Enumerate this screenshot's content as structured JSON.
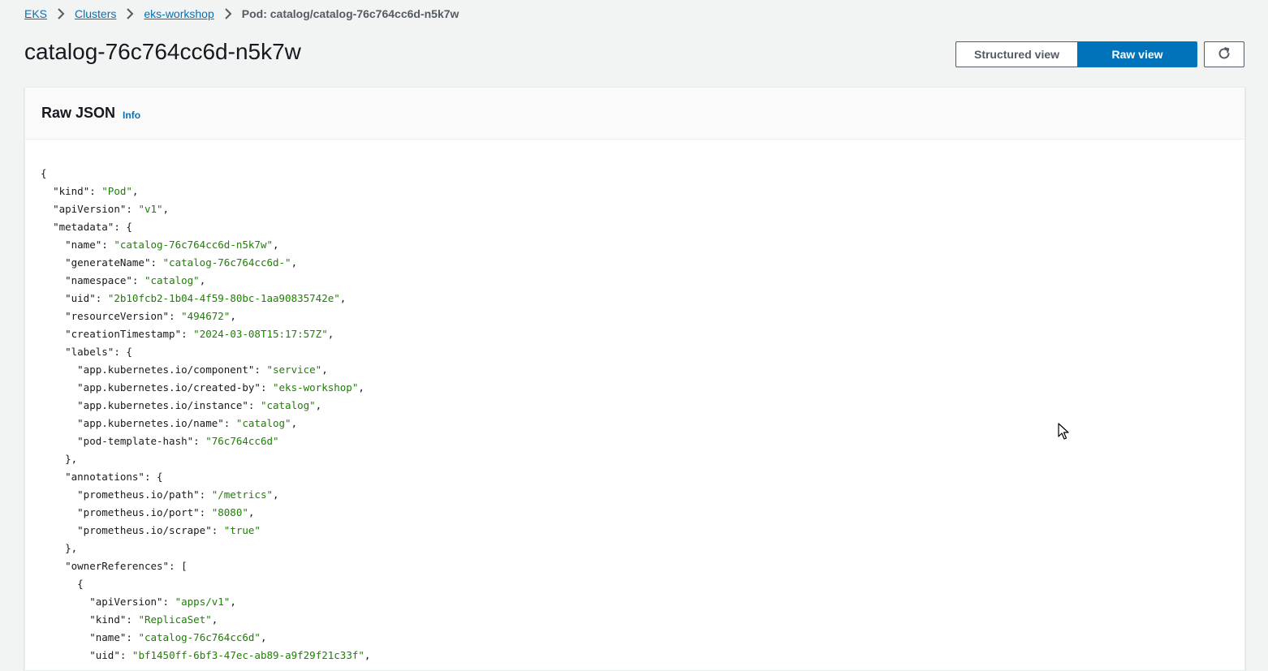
{
  "breadcrumb": {
    "items": [
      "EKS",
      "Clusters",
      "eks-workshop"
    ],
    "current": "Pod: catalog/catalog-76c764cc6d-n5k7w"
  },
  "page": {
    "title": "catalog-76c764cc6d-n5k7w"
  },
  "view_toggle": {
    "structured_label": "Structured view",
    "raw_label": "Raw view",
    "selected": "Raw view"
  },
  "refresh": {
    "icon": "refresh-icon"
  },
  "panel": {
    "title": "Raw JSON",
    "info_label": "Info"
  },
  "colors": {
    "accent": "#0073bb",
    "string": "#1d8102",
    "background": "#f2f3f3"
  },
  "json_lines": [
    {
      "indent": 0,
      "text": "{"
    },
    {
      "indent": 1,
      "key": "kind",
      "value": "Pod",
      "comma": true
    },
    {
      "indent": 1,
      "key": "apiVersion",
      "value": "v1",
      "comma": true
    },
    {
      "indent": 1,
      "key": "metadata",
      "open": "{"
    },
    {
      "indent": 2,
      "key": "name",
      "value": "catalog-76c764cc6d-n5k7w",
      "comma": true
    },
    {
      "indent": 2,
      "key": "generateName",
      "value": "catalog-76c764cc6d-",
      "comma": true
    },
    {
      "indent": 2,
      "key": "namespace",
      "value": "catalog",
      "comma": true
    },
    {
      "indent": 2,
      "key": "uid",
      "value": "2b10fcb2-1b04-4f59-80bc-1aa90835742e",
      "comma": true
    },
    {
      "indent": 2,
      "key": "resourceVersion",
      "value": "494672",
      "comma": true
    },
    {
      "indent": 2,
      "key": "creationTimestamp",
      "value": "2024-03-08T15:17:57Z",
      "comma": true
    },
    {
      "indent": 2,
      "key": "labels",
      "open": "{"
    },
    {
      "indent": 3,
      "key": "app.kubernetes.io/component",
      "value": "service",
      "comma": true
    },
    {
      "indent": 3,
      "key": "app.kubernetes.io/created-by",
      "value": "eks-workshop",
      "comma": true
    },
    {
      "indent": 3,
      "key": "app.kubernetes.io/instance",
      "value": "catalog",
      "comma": true
    },
    {
      "indent": 3,
      "key": "app.kubernetes.io/name",
      "value": "catalog",
      "comma": true
    },
    {
      "indent": 3,
      "key": "pod-template-hash",
      "value": "76c764cc6d",
      "comma": false
    },
    {
      "indent": 2,
      "text": "},"
    },
    {
      "indent": 2,
      "key": "annotations",
      "open": "{"
    },
    {
      "indent": 3,
      "key": "prometheus.io/path",
      "value": "/metrics",
      "comma": true
    },
    {
      "indent": 3,
      "key": "prometheus.io/port",
      "value": "8080",
      "comma": true
    },
    {
      "indent": 3,
      "key": "prometheus.io/scrape",
      "value": "true",
      "comma": false
    },
    {
      "indent": 2,
      "text": "},"
    },
    {
      "indent": 2,
      "key": "ownerReferences",
      "open": "["
    },
    {
      "indent": 3,
      "text": "{"
    },
    {
      "indent": 4,
      "key": "apiVersion",
      "value": "apps/v1",
      "comma": true
    },
    {
      "indent": 4,
      "key": "kind",
      "value": "ReplicaSet",
      "comma": true
    },
    {
      "indent": 4,
      "key": "name",
      "value": "catalog-76c764cc6d",
      "comma": true
    },
    {
      "indent": 4,
      "key": "uid",
      "value": "bf1450ff-6bf3-47ec-ab89-a9f29f21c33f",
      "comma": true
    }
  ]
}
